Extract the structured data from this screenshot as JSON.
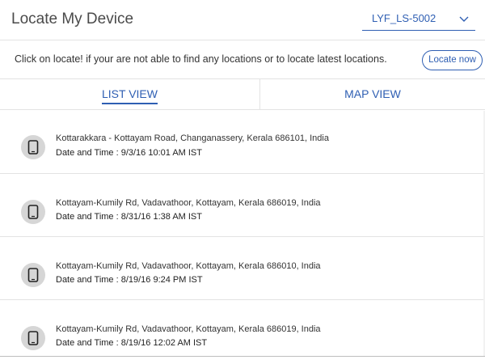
{
  "header": {
    "title": "Locate My Device",
    "device_selected": "LYF_LS-5002",
    "dropdown_icon": "chevron-down-icon"
  },
  "infobar": {
    "message": "Click on locate! if your are not able to find any locations or to locate latest locations.",
    "locate_button": "Locate now"
  },
  "tabs": [
    {
      "label": "LIST VIEW",
      "active": true
    },
    {
      "label": "MAP VIEW",
      "active": false
    }
  ],
  "locations": [
    {
      "icon": "phone-icon",
      "address": "Kottarakkara - Kottayam Road, Changanassery, Kerala 686101, India",
      "datetime": "Date and Time : 9/3/16 10:01 AM IST"
    },
    {
      "icon": "phone-icon",
      "address": "Kottayam-Kumily Rd, Vadavathoor, Kottayam, Kerala 686019, India",
      "datetime": "Date and Time : 8/31/16 1:38 AM IST"
    },
    {
      "icon": "phone-icon",
      "address": "Kottayam-Kumily Rd, Vadavathoor, Kottayam, Kerala 686010, India",
      "datetime": "Date and Time : 8/19/16 9:24 PM IST"
    },
    {
      "icon": "phone-icon",
      "address": "Kottayam-Kumily Rd, Vadavathoor, Kottayam, Kerala 686019, India",
      "datetime": "Date and Time : 8/19/16 12:02 AM IST"
    }
  ],
  "colors": {
    "accent": "#2f5fb3",
    "badge_bg": "#d6d6d6",
    "divider": "#e3e3e3"
  }
}
